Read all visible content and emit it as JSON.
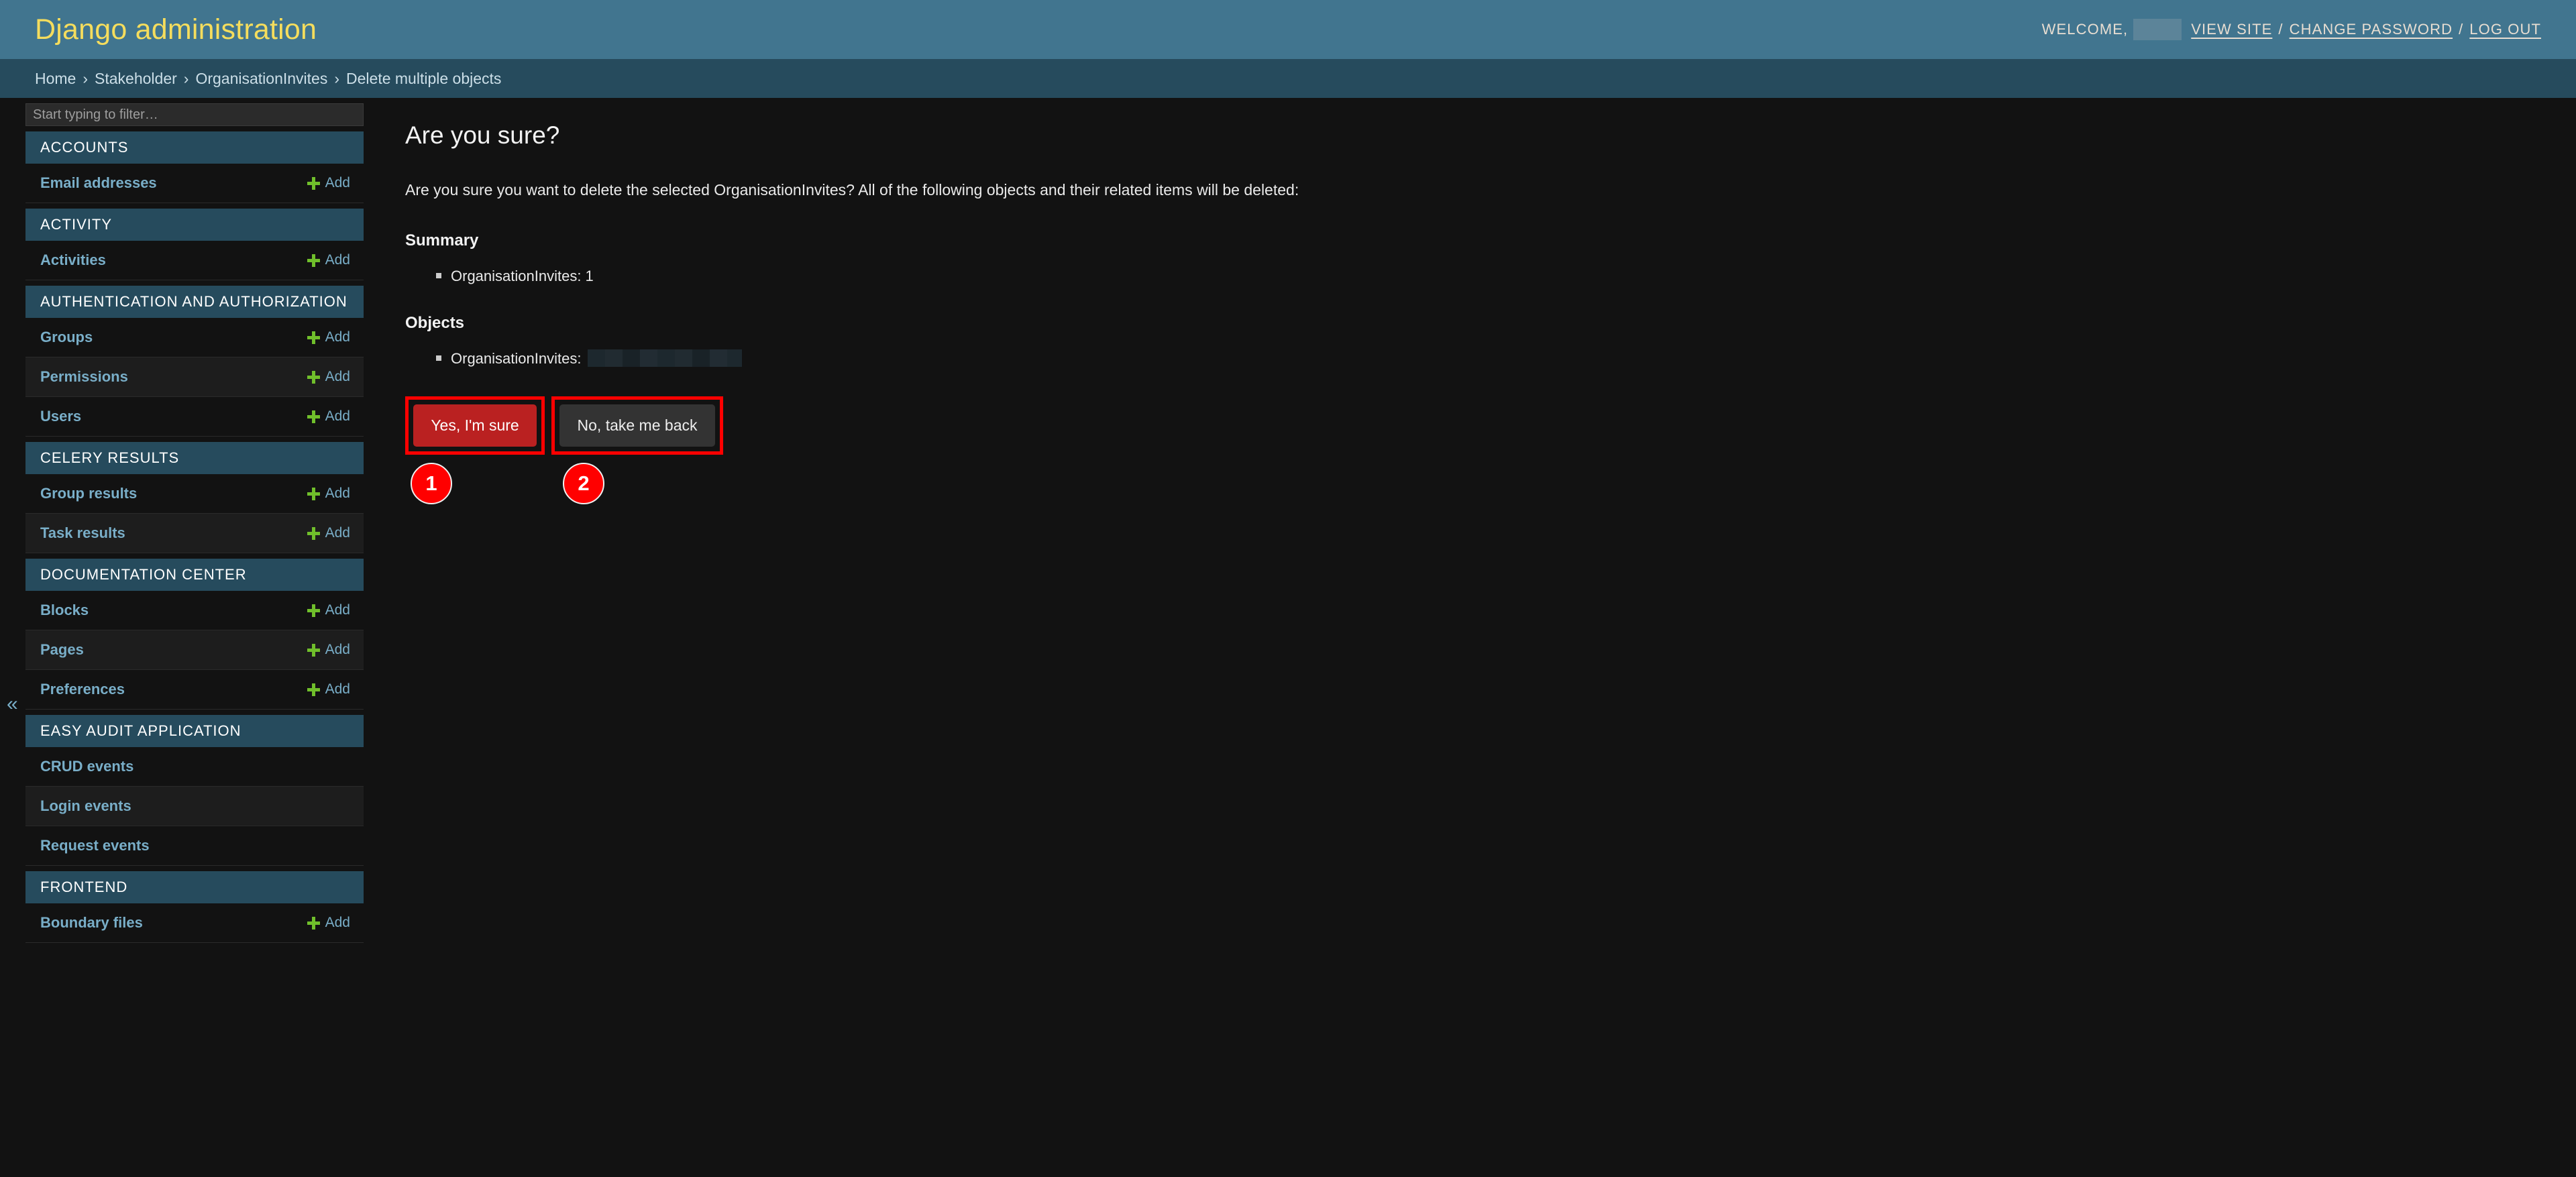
{
  "header": {
    "brand": "Django administration",
    "welcome_label": "WELCOME,",
    "username_redacted": "",
    "links": [
      {
        "label": "VIEW SITE"
      },
      {
        "label": "CHANGE PASSWORD"
      },
      {
        "label": "LOG OUT"
      }
    ],
    "separator": "/"
  },
  "breadcrumbs": {
    "separator": "›",
    "items": [
      {
        "label": "Home"
      },
      {
        "label": "Stakeholder"
      },
      {
        "label": "OrganisationInvites"
      },
      {
        "label": "Delete multiple objects"
      }
    ]
  },
  "sidebar": {
    "filter_placeholder": "Start typing to filter…",
    "filter_value": "",
    "collapse_icon": "«",
    "add_label": "Add",
    "apps": [
      {
        "title": "ACCOUNTS",
        "models": [
          {
            "label": "Email addresses",
            "has_add": true
          }
        ]
      },
      {
        "title": "ACTIVITY",
        "models": [
          {
            "label": "Activities",
            "has_add": true
          }
        ]
      },
      {
        "title": "AUTHENTICATION AND AUTHORIZATION",
        "models": [
          {
            "label": "Groups",
            "has_add": true
          },
          {
            "label": "Permissions",
            "has_add": true
          },
          {
            "label": "Users",
            "has_add": true
          }
        ]
      },
      {
        "title": "CELERY RESULTS",
        "models": [
          {
            "label": "Group results",
            "has_add": true
          },
          {
            "label": "Task results",
            "has_add": true
          }
        ]
      },
      {
        "title": "DOCUMENTATION CENTER",
        "models": [
          {
            "label": "Blocks",
            "has_add": true
          },
          {
            "label": "Pages",
            "has_add": true
          },
          {
            "label": "Preferences",
            "has_add": true
          }
        ]
      },
      {
        "title": "EASY AUDIT APPLICATION",
        "models": [
          {
            "label": "CRUD events",
            "has_add": false
          },
          {
            "label": "Login events",
            "has_add": false
          },
          {
            "label": "Request events",
            "has_add": false
          }
        ]
      },
      {
        "title": "FRONTEND",
        "models": [
          {
            "label": "Boundary files",
            "has_add": true
          }
        ]
      }
    ]
  },
  "main": {
    "title": "Are you sure?",
    "intro": "Are you sure you want to delete the selected OrganisationInvites? All of the following objects and their related items will be deleted:",
    "summary_heading": "Summary",
    "summary_items": [
      {
        "label": "OrganisationInvites: 1"
      }
    ],
    "objects_heading": "Objects",
    "objects_items": [
      {
        "label": "OrganisationInvites:",
        "redacted": true
      }
    ],
    "confirm_button": "Yes, I'm sure",
    "cancel_button": "No, take me back"
  },
  "annotations": {
    "markers": [
      {
        "number": "1"
      },
      {
        "number": "2"
      }
    ]
  },
  "colors": {
    "header_bg": "#41758f",
    "breadcrumb_bg": "#264b5d",
    "brand_text": "#f5dd5d",
    "link_blue": "#79aec8",
    "add_green": "#70bf2b",
    "danger_red": "#ba2121",
    "annotation_red": "#ff0000",
    "page_bg": "#121212"
  }
}
